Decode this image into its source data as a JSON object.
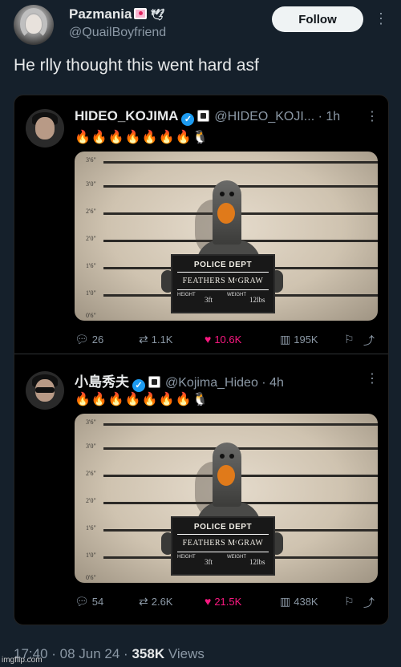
{
  "author": {
    "display_name": "Pazmania",
    "handle": "@QuailBoyfriend",
    "follow_label": "Follow"
  },
  "tweet": {
    "text": "He rlly thought this went hard asf"
  },
  "embedded_tweets": [
    {
      "name": "HIDEO_KOJIMA",
      "handle_time": "@HIDEO_KOJI... · 1h",
      "fires": "🔥🔥🔥🔥🔥🔥🔥🐧",
      "photo": {
        "title": "POLICE DEPT",
        "name": "FEATHERS MᶜGRAW",
        "height_label": "HEIGHT",
        "height_value": "3ft",
        "weight_label": "WEIGHT",
        "weight_value": "12lbs",
        "ticks": [
          "3'6\"",
          "3'0\"",
          "2'6\"",
          "2'0\"",
          "1'6\"",
          "1'0\"",
          "0'6\""
        ]
      },
      "stats": {
        "replies": "26",
        "reposts": "1.1K",
        "likes": "10.6K",
        "views": "195K"
      }
    },
    {
      "name": "小島秀夫",
      "handle_time": "@Kojima_Hideo · 4h",
      "fires": "🔥🔥🔥🔥🔥🔥🔥🐧",
      "photo": {
        "title": "POLICE DEPT",
        "name": "FEATHERS MᶜGRAW",
        "height_label": "HEIGHT",
        "height_value": "3ft",
        "weight_label": "WEIGHT",
        "weight_value": "12lbs",
        "ticks": [
          "3'6\"",
          "3'0\"",
          "2'6\"",
          "2'0\"",
          "1'6\"",
          "1'0\"",
          "0'6\""
        ]
      },
      "stats": {
        "replies": "54",
        "reposts": "2.6K",
        "likes": "21.5K",
        "views": "438K"
      }
    }
  ],
  "footer": {
    "timestamp": "17:40 · 08 Jun 24 ·",
    "views_count": "358K",
    "views_label": "Views"
  },
  "watermark": "imgflip.com"
}
